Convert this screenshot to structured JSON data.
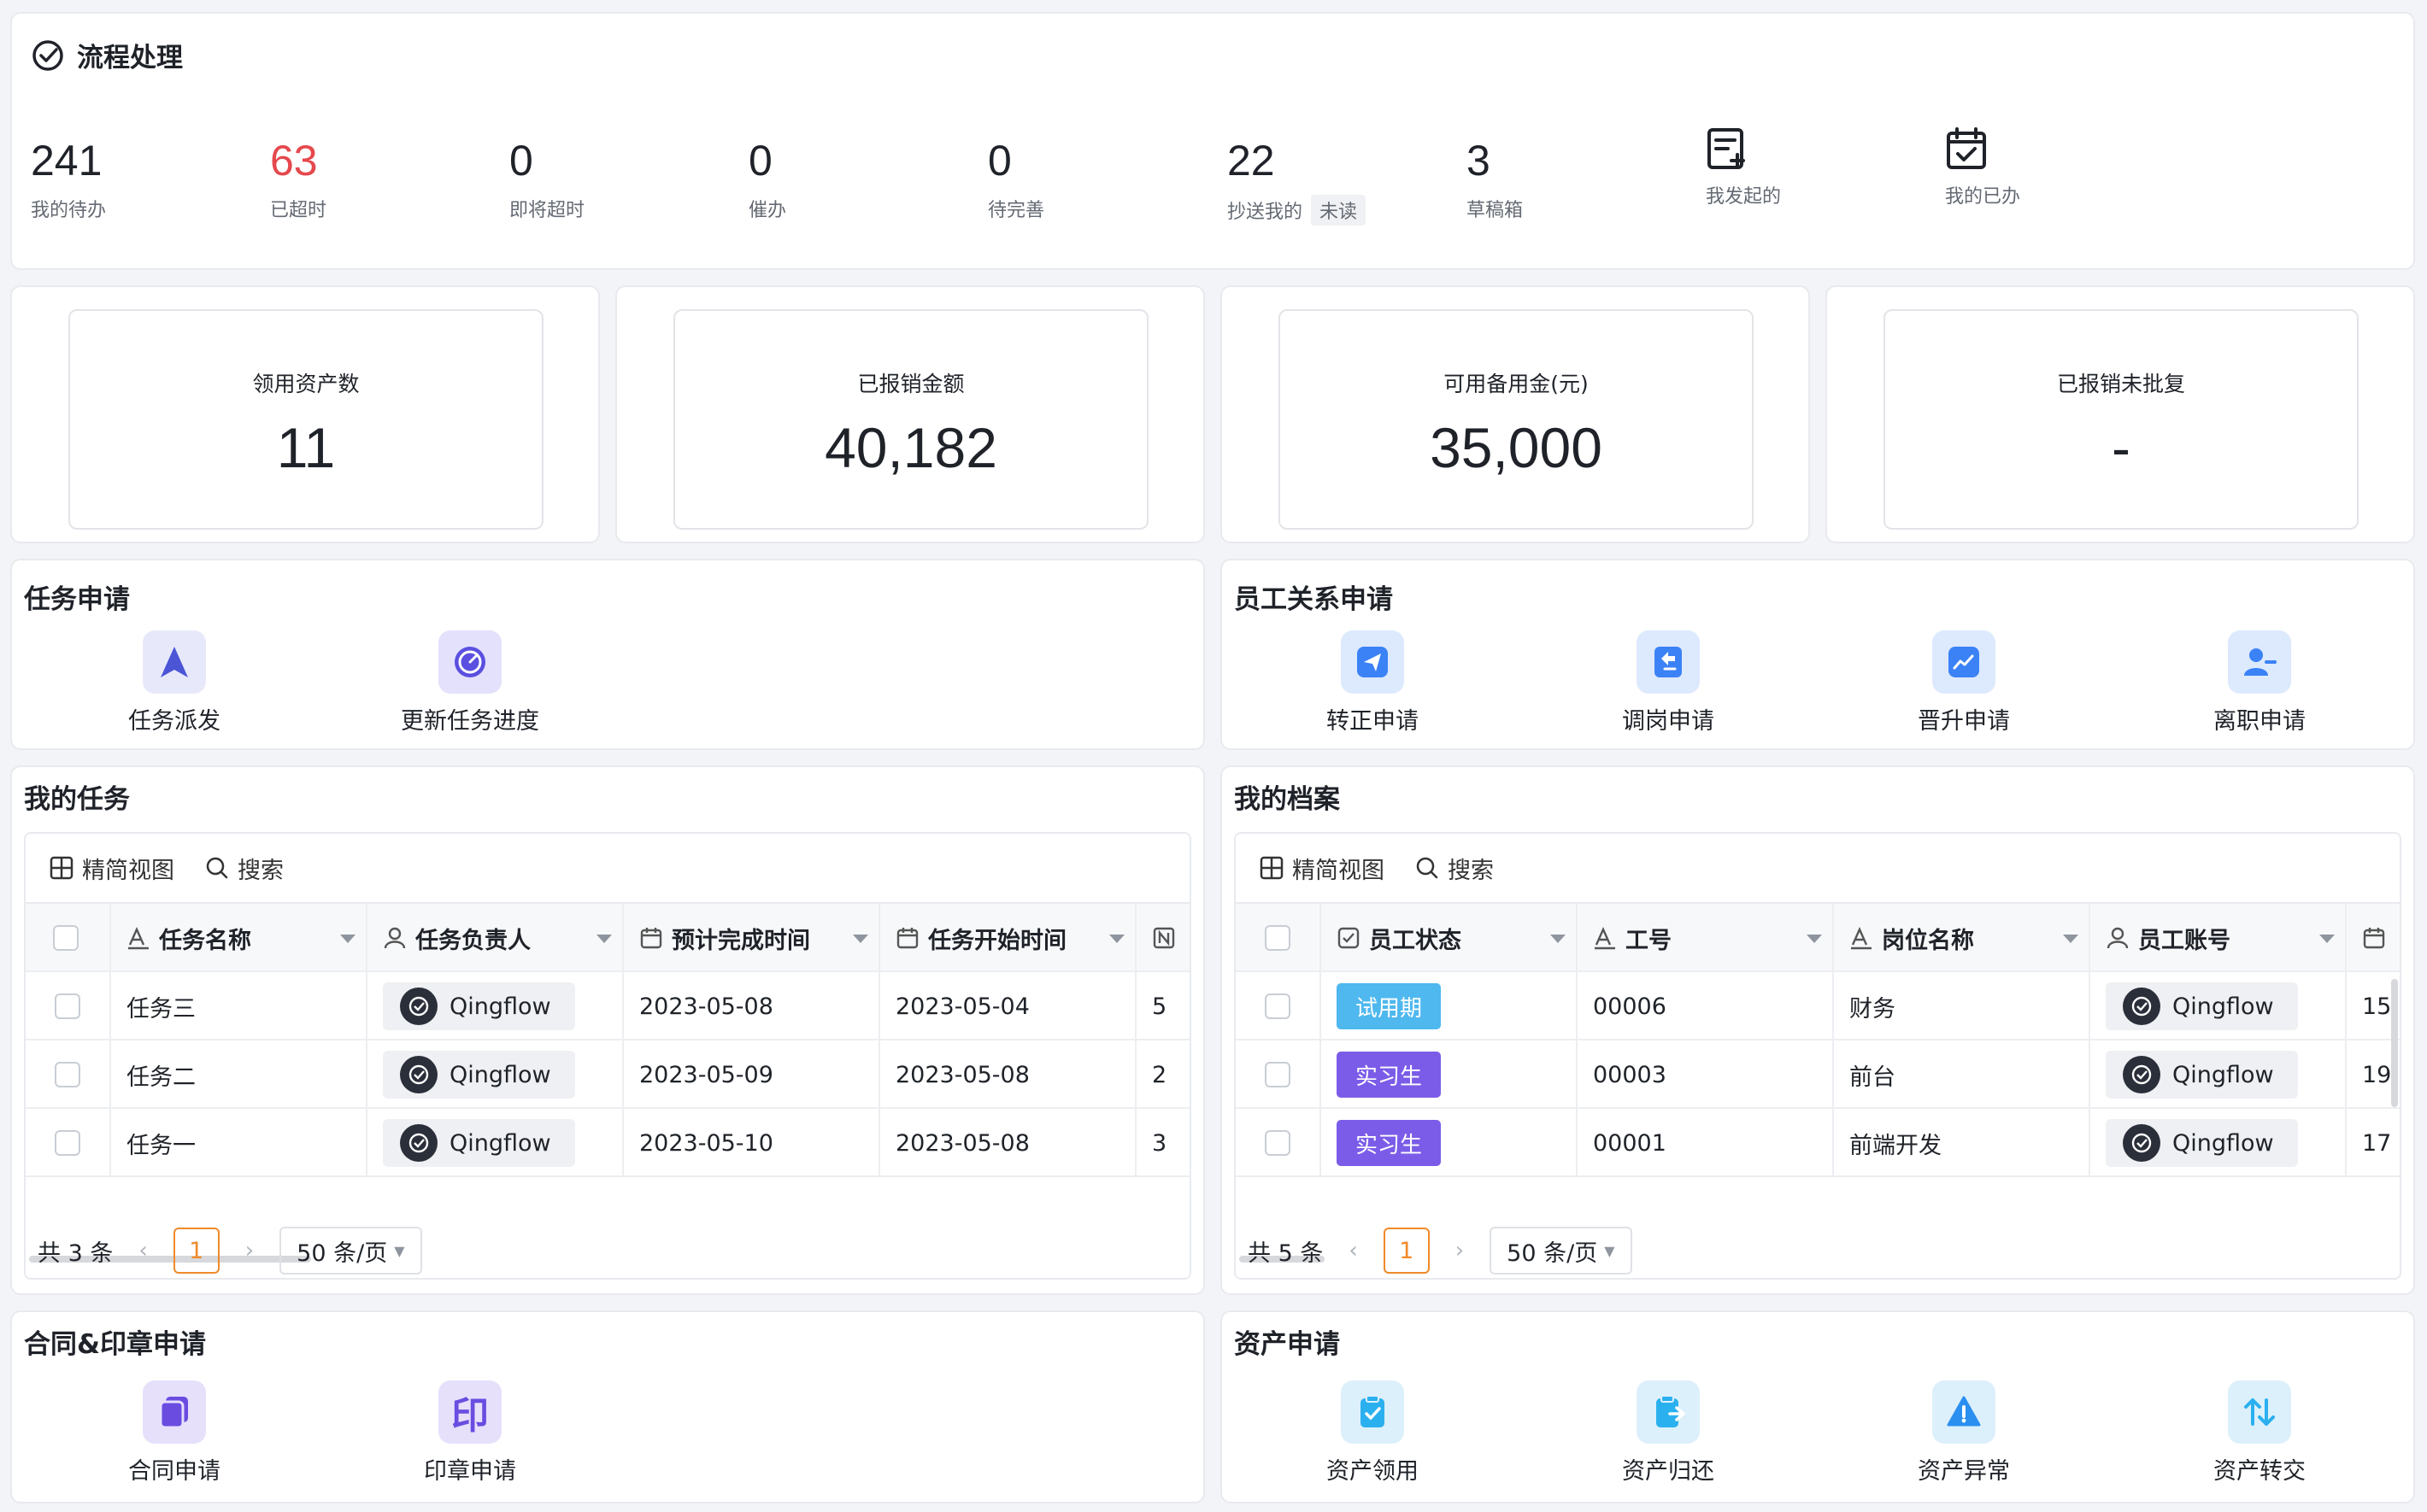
{
  "process": {
    "title": "流程处理",
    "stats": [
      {
        "value": "241",
        "label": "我的待办"
      },
      {
        "value": "63",
        "label": "已超时"
      },
      {
        "value": "0",
        "label": "即将超时"
      },
      {
        "value": "0",
        "label": "催办"
      },
      {
        "value": "0",
        "label": "待完善"
      },
      {
        "value": "22",
        "label": "抄送我的",
        "badge": "未读"
      },
      {
        "value": "3",
        "label": "草稿箱"
      }
    ],
    "shortcuts": [
      {
        "label": "我发起的",
        "icon": "edit-document-icon"
      },
      {
        "label": "我的已办",
        "icon": "calendar-check-icon"
      }
    ]
  },
  "metrics": [
    {
      "label": "领用资产数",
      "value": "11"
    },
    {
      "label": "已报销金额",
      "value": "40,182"
    },
    {
      "label": "可用备用金(元)",
      "value": "35,000"
    },
    {
      "label": "已报销未批复",
      "value": "-"
    }
  ],
  "task_apply": {
    "title": "任务申请",
    "apps": [
      {
        "label": "任务派发",
        "icon": "navigation-arrow-icon"
      },
      {
        "label": "更新任务进度",
        "icon": "gauge-icon"
      }
    ]
  },
  "employee_apply": {
    "title": "员工关系申请",
    "apps": [
      {
        "label": "转正申请",
        "icon": "send-icon"
      },
      {
        "label": "调岗申请",
        "icon": "transfer-icon"
      },
      {
        "label": "晋升申请",
        "icon": "trend-up-icon"
      },
      {
        "label": "离职申请",
        "icon": "user-remove-icon"
      }
    ]
  },
  "my_tasks": {
    "title": "我的任务",
    "toolbar": {
      "view": "精简视图",
      "search": "搜索"
    },
    "columns": [
      "任务名称",
      "任务负责人",
      "预计完成时间",
      "任务开始时间"
    ],
    "rows": [
      {
        "name": "任务三",
        "owner": "Qingflow",
        "due": "2023-05-08",
        "start": "2023-05-04",
        "extra": "5"
      },
      {
        "name": "任务二",
        "owner": "Qingflow",
        "due": "2023-05-09",
        "start": "2023-05-08",
        "extra": "2"
      },
      {
        "name": "任务一",
        "owner": "Qingflow",
        "due": "2023-05-10",
        "start": "2023-05-08",
        "extra": "3"
      }
    ],
    "pager": {
      "total": "共 3 条",
      "page": "1",
      "size": "50 条/页"
    }
  },
  "my_profile": {
    "title": "我的档案",
    "toolbar": {
      "view": "精简视图",
      "search": "搜索"
    },
    "columns": [
      "员工状态",
      "工号",
      "岗位名称",
      "员工账号"
    ],
    "rows": [
      {
        "status": "试用期",
        "status_color": "#4fb8ef",
        "id": "00006",
        "position": "财务",
        "account": "Qingflow",
        "extra": "15"
      },
      {
        "status": "实习生",
        "status_color": "#7b5ce8",
        "id": "00003",
        "position": "前台",
        "account": "Qingflow",
        "extra": "19"
      },
      {
        "status": "实习生",
        "status_color": "#7b5ce8",
        "id": "00001",
        "position": "前端开发",
        "account": "Qingflow",
        "extra": "17"
      }
    ],
    "pager": {
      "total": "共 5 条",
      "page": "1",
      "size": "50 条/页"
    }
  },
  "contract_apply": {
    "title": "合同&印章申请",
    "apps": [
      {
        "label": "合同申请",
        "icon": "copy-document-icon"
      },
      {
        "label": "印章申请",
        "icon": "seal-icon",
        "glyph": "印"
      }
    ]
  },
  "asset_apply": {
    "title": "资产申请",
    "apps": [
      {
        "label": "资产领用",
        "icon": "clipboard-check-icon"
      },
      {
        "label": "资产归还",
        "icon": "clipboard-return-icon"
      },
      {
        "label": "资产异常",
        "icon": "warning-icon"
      },
      {
        "label": "资产转交",
        "icon": "swap-arrows-icon"
      }
    ]
  }
}
